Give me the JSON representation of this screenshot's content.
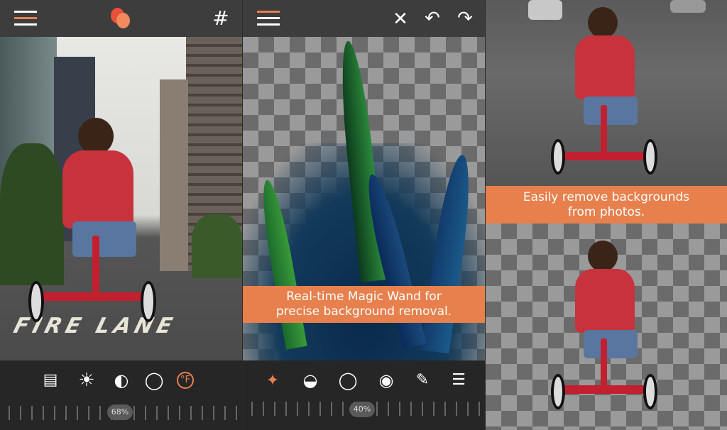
{
  "panel1": {
    "topbar": {
      "menu_icon": "hamburger-icon",
      "logo_icon": "overlapping-circles-logo",
      "grid_icon": "grid-icon"
    },
    "tools": [
      "layers-icon",
      "brightness-icon",
      "exposure-icon",
      "gradient-icon",
      "temperature-icon"
    ],
    "active_tool": "temperature-icon",
    "slider_label": "68%",
    "slider_value": 68,
    "street_text": "FIRE LANE"
  },
  "panel2": {
    "topbar": {
      "menu_icon": "hamburger-icon",
      "close_icon": "close-icon",
      "undo_icon": "undo-icon",
      "redo_icon": "redo-icon"
    },
    "tools": [
      "magic-wand-icon",
      "half-circle-icon",
      "circle-icon",
      "eye-icon",
      "marker-icon",
      "eraser-brush-icon"
    ],
    "active_tool": "magic-wand-icon",
    "slider_label": "40%",
    "slider_value": 40,
    "caption_line1": "Real-time Magic Wand for",
    "caption_line2": "precise background removal."
  },
  "panel3": {
    "caption_line1": "Easily remove backgrounds",
    "caption_line2": "from photos."
  },
  "colors": {
    "accent": "#e7804d",
    "topbar": "#3d3d3d",
    "bottombar": "#262626"
  }
}
